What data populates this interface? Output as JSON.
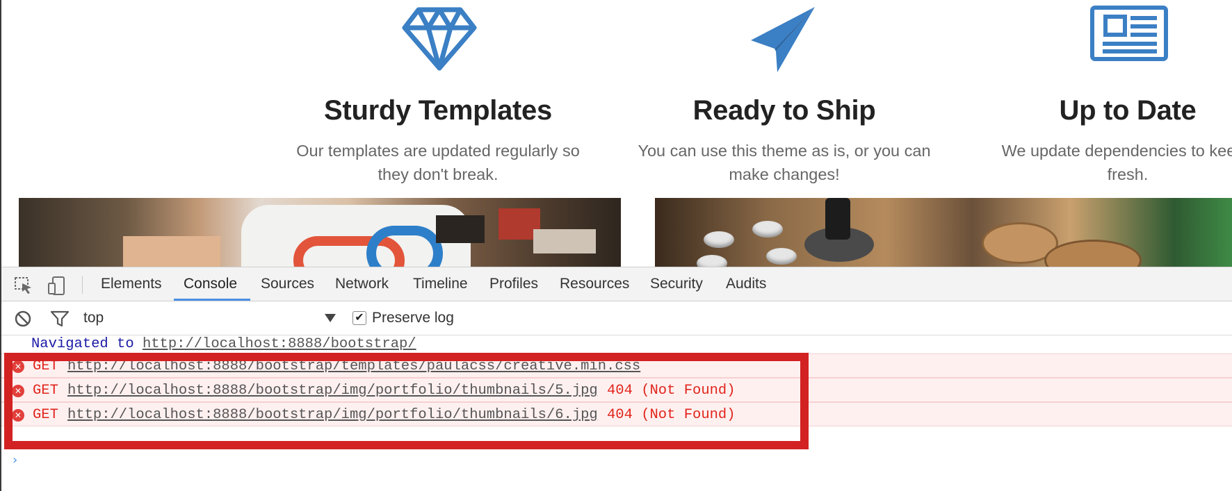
{
  "features": [
    {
      "icon": "diamond-icon",
      "title": "Sturdy Templates",
      "text_line1": "Our templates are updated regularly so",
      "text_line2": "they don't break."
    },
    {
      "icon": "paper-plane-icon",
      "title": "Ready to Ship",
      "text_line1": "You can use this theme as is, or you can",
      "text_line2": "make changes!"
    },
    {
      "icon": "newspaper-icon",
      "title": "Up to Date",
      "text_line1": "We update dependencies to keep t",
      "text_line2": "fresh."
    }
  ],
  "colors": {
    "accent": "#3b7fc4",
    "error": "#e0251b",
    "highlight": "#d32222",
    "tab_active": "#4a8fe2"
  },
  "devtools": {
    "tools": [
      "inspect-element-icon",
      "device-mode-icon"
    ],
    "tabs": [
      "Elements",
      "Console",
      "Sources",
      "Network",
      "Timeline",
      "Profiles",
      "Resources",
      "Security",
      "Audits"
    ],
    "active_tab": "Console",
    "filter_bar": {
      "context": "top",
      "preserve_log_label": "Preserve log",
      "preserve_log_checked": true
    },
    "console": {
      "navigated_prefix": "Navigated to",
      "navigated_url": "http://localhost:8888/bootstrap/",
      "errors": [
        {
          "method": "GET",
          "url": "http://localhost:8888/bootstrap/templates/paulacss/creative.min.css",
          "status": ""
        },
        {
          "method": "GET",
          "url": "http://localhost:8888/bootstrap/img/portfolio/thumbnails/5.jpg",
          "status": "404 (Not Found)"
        },
        {
          "method": "GET",
          "url": "http://localhost:8888/bootstrap/img/portfolio/thumbnails/6.jpg",
          "status": "404 (Not Found)"
        }
      ]
    }
  }
}
